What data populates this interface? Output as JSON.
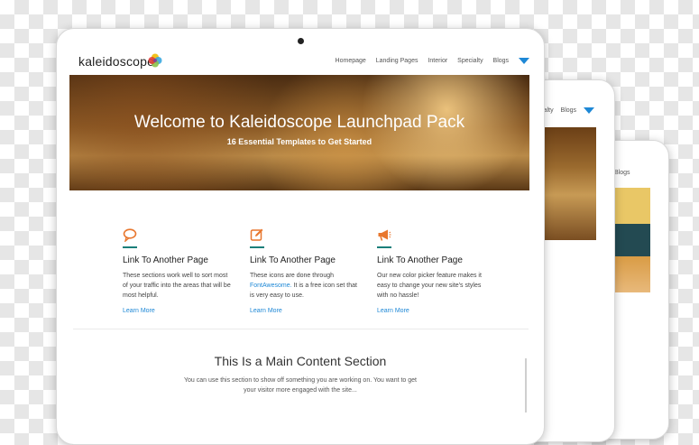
{
  "back_device_1": {
    "nav": [
      "ecialty",
      "Blogs"
    ]
  },
  "back_device_2": {
    "nav": [
      "Blogs"
    ]
  },
  "header": {
    "logo": "kaleidoscope",
    "nav": [
      "Homepage",
      "Landing Pages",
      "Interior",
      "Specialty",
      "Blogs"
    ]
  },
  "hero": {
    "title": "Welcome to Kaleidoscope Launchpad Pack",
    "subtitle": "16 Essential Templates to Get Started"
  },
  "features": [
    {
      "icon": "speech-bubble-icon",
      "title": "Link To Another Page",
      "body": "These sections work well to sort most of your traffic into the areas that will be most helpful.",
      "link": "Learn More"
    },
    {
      "icon": "edit-icon",
      "title": "Link To Another Page",
      "body_before": "These icons are done through",
      "body_link": "FontAwesome.",
      "body_after": " It is a free icon set that is very easy to use.",
      "link": "Learn More"
    },
    {
      "icon": "megaphone-icon",
      "title": "Link To Another Page",
      "body": "Our new color picker feature makes it easy to change your new site's styles with no hassle!",
      "link": "Learn More"
    }
  ],
  "main_section": {
    "title": "This Is a Main Content Section",
    "body": "You can use this section to show off something you are working on. You want to get your visitor more engaged with the site..."
  },
  "colors": {
    "accent_orange": "#e8772e",
    "link_blue": "#1e88d6",
    "teal": "#1a7f7a"
  }
}
